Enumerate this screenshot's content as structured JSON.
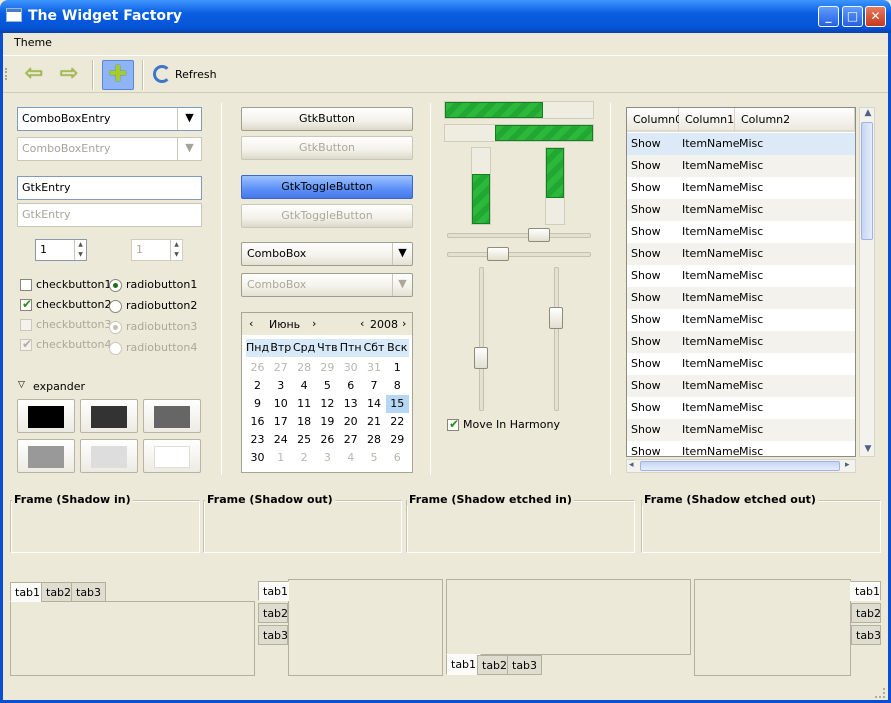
{
  "window": {
    "title": "The Widget Factory"
  },
  "menubar": {
    "items": [
      "Theme"
    ]
  },
  "toolbar": {
    "refresh_label": "Refresh"
  },
  "col1": {
    "combo_entry": "ComboBoxEntry",
    "combo_entry_disabled": "ComboBoxEntry",
    "entry": "GtkEntry",
    "entry_disabled": "GtkEntry",
    "spin1": "1",
    "spin2": "1",
    "check1": "checkbutton1",
    "check2": "checkbutton2",
    "check3": "checkbutton3",
    "check4": "checkbutton4",
    "radio1": "radiobutton1",
    "radio2": "radiobutton2",
    "radio3": "radiobutton3",
    "radio4": "radiobutton4",
    "expander": "expander",
    "swatches": [
      "#000000",
      "#333333",
      "#666666",
      "#999999",
      "#dddddd",
      "#ffffff"
    ]
  },
  "col2": {
    "button": "GtkButton",
    "button_disabled": "GtkButton",
    "toggle": "GtkToggleButton",
    "toggle_disabled": "GtkToggleButton",
    "combo": "ComboBox",
    "combo_disabled": "ComboBox"
  },
  "calendar": {
    "month": "Июнь",
    "year": "2008",
    "day_names": [
      "Пнд",
      "Втр",
      "Срд",
      "Чтв",
      "Птн",
      "Сбт",
      "Вск"
    ],
    "weeks": [
      [
        "26",
        "27",
        "28",
        "29",
        "30",
        "31",
        "1"
      ],
      [
        "2",
        "3",
        "4",
        "5",
        "6",
        "7",
        "8"
      ],
      [
        "9",
        "10",
        "11",
        "12",
        "13",
        "14",
        "15"
      ],
      [
        "16",
        "17",
        "18",
        "19",
        "20",
        "21",
        "22"
      ],
      [
        "23",
        "24",
        "25",
        "26",
        "27",
        "28",
        "29"
      ],
      [
        "30",
        "1",
        "2",
        "3",
        "4",
        "5",
        "6"
      ]
    ],
    "selected": "15"
  },
  "col3": {
    "progress_h1": 0.66,
    "progress_h2": 0.66,
    "progress_v1": 0.66,
    "progress_v2": 0.66,
    "harmony_label": "Move In Harmony"
  },
  "tree": {
    "columns": [
      "Column0",
      "Column1",
      "Column2"
    ],
    "rows": [
      [
        "Show",
        "ItemName",
        "Misc"
      ],
      [
        "Show",
        "ItemName",
        "Misc"
      ],
      [
        "Show",
        "ItemName",
        "Misc"
      ],
      [
        "Show",
        "ItemName",
        "Misc"
      ],
      [
        "Show",
        "ItemName",
        "Misc"
      ],
      [
        "Show",
        "ItemName",
        "Misc"
      ],
      [
        "Show",
        "ItemName",
        "Misc"
      ],
      [
        "Show",
        "ItemName",
        "Misc"
      ],
      [
        "Show",
        "ItemName",
        "Misc"
      ],
      [
        "Show",
        "ItemName",
        "Misc"
      ],
      [
        "Show",
        "ItemName",
        "Misc"
      ],
      [
        "Show",
        "ItemName",
        "Misc"
      ],
      [
        "Show",
        "ItemName",
        "Misc"
      ],
      [
        "Show",
        "ItemName",
        "Misc"
      ],
      [
        "Show",
        "ItemName",
        "Misc"
      ]
    ]
  },
  "frames": [
    "Frame (Shadow in)",
    "Frame (Shadow out)",
    "Frame (Shadow etched in)",
    "Frame (Shadow etched out)"
  ],
  "tabs": [
    "tab1",
    "tab2",
    "tab3"
  ]
}
